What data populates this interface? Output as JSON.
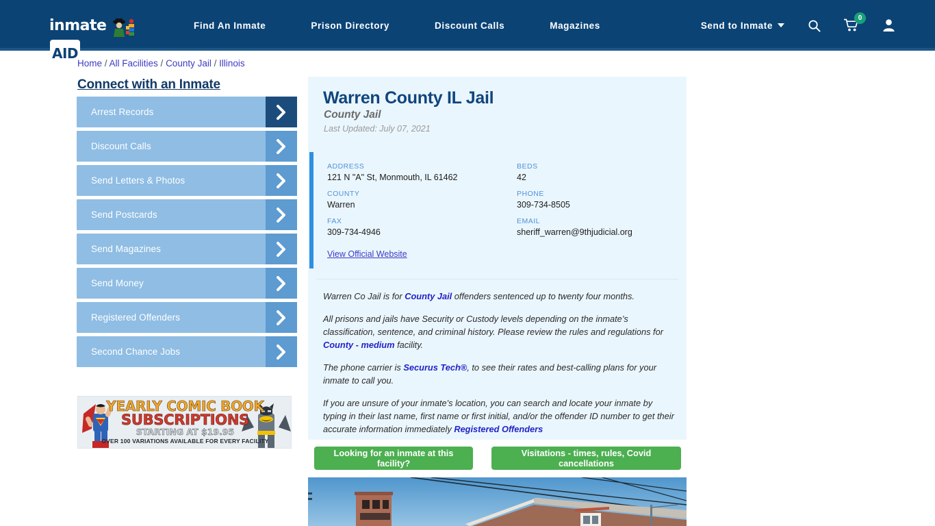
{
  "header": {
    "logo": {
      "text": "inmate",
      "badge": "AID",
      "icon": "inmate-aid-logo"
    },
    "nav": [
      {
        "label": "Find An Inmate"
      },
      {
        "label": "Prison Directory"
      },
      {
        "label": "Discount Calls"
      },
      {
        "label": "Magazines"
      }
    ],
    "send_to_inmate": "Send to Inmate",
    "icons": {
      "search": "search-icon",
      "cart": "shopping-cart-icon",
      "account": "user-account-icon"
    },
    "cart_count": "0",
    "colors": {
      "bar": "#0b4375",
      "badge": "#17a07a"
    }
  },
  "breadcrumb": {
    "items": [
      "Home",
      "All Facilities",
      "County Jail",
      "Illinois"
    ],
    "separator": "/"
  },
  "sidebar": {
    "title": "Connect with an Inmate",
    "items": [
      {
        "label": "Arrest Records",
        "active": true
      },
      {
        "label": "Discount Calls",
        "active": false
      },
      {
        "label": "Send Letters & Photos",
        "active": false
      },
      {
        "label": "Send Postcards",
        "active": false
      },
      {
        "label": "Send Magazines",
        "active": false
      },
      {
        "label": "Send Money",
        "active": false
      },
      {
        "label": "Registered Offenders",
        "active": false
      },
      {
        "label": "Second Chance Jobs",
        "active": false
      }
    ]
  },
  "ad": {
    "line1": "YEARLY COMIC BOOK",
    "line2": "SUBSCRIPTIONS",
    "line3": "STARTING AT $19.95",
    "line4": "OVER 100 VARIATIONS AVAILABLE FOR EVERY FACILITY",
    "left_character": "superman-figure",
    "right_character": "batman-figure"
  },
  "facility": {
    "title": "Warren County IL Jail",
    "type": "County Jail",
    "last_updated": "Last Updated: July 07, 2021",
    "fields": {
      "address_label": "ADDRESS",
      "address_value": "121 N \"A\" St, Monmouth, IL 61462",
      "county_label": "COUNTY",
      "county_value": "Warren",
      "fax_label": "FAX",
      "fax_value": "309-734-4946",
      "beds_label": "BEDS",
      "beds_value": "42",
      "phone_label": "PHONE",
      "phone_value": "309-734-8505",
      "email_label": "EMAIL",
      "email_value": "sheriff_warren@9thjudicial.org"
    },
    "official_website_link": "View Official Website"
  },
  "description": {
    "p1_a": "Warren Co Jail is for ",
    "p1_link": "County Jail",
    "p1_b": " offenders sentenced up to twenty four months.",
    "p2_a": "All prisons and jails have Security or Custody levels depending on the inmate’s classification, sentence, and criminal history. Please review the rules and regulations for ",
    "p2_link": "County - medium",
    "p2_b": " facility.",
    "p3_a": "The phone carrier is ",
    "p3_link": "Securus Tech®",
    "p3_b": ", to see their rates and best-calling plans for your inmate to call you.",
    "p4_a": "If you are unsure of your inmate's location, you can search and locate your inmate by typing in their last name, first name or first initial, and/or the offender ID number to get their accurate information immediately ",
    "p4_link": "Registered Offenders"
  },
  "actions": {
    "button1": "Looking for an inmate at this facility?",
    "button2": "Visitations - times, rules, Covid cancellations",
    "color": "#4caf50"
  },
  "photo": {
    "caption": "facility-exterior-photo"
  }
}
